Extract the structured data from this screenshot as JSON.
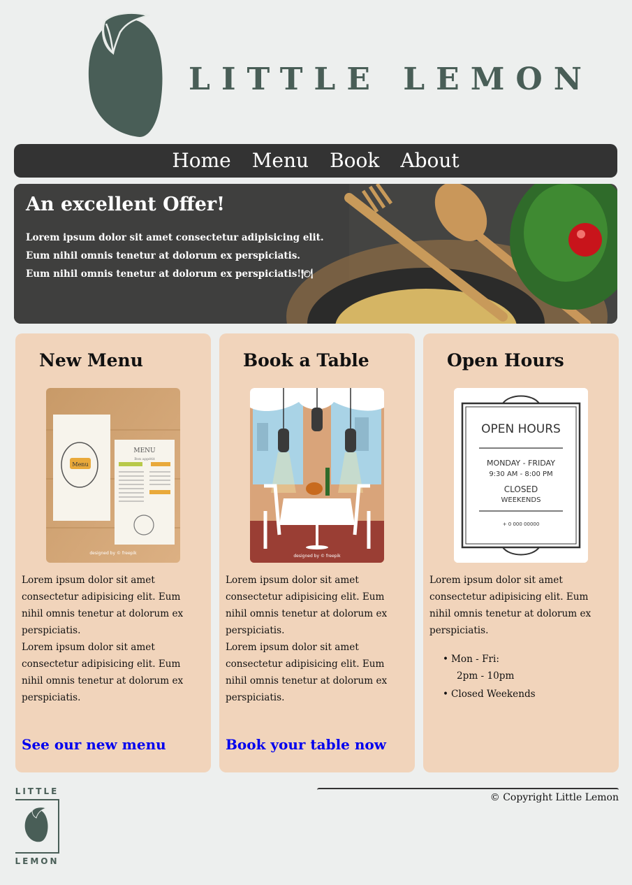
{
  "brand": {
    "name": "LITTLE LEMON",
    "footer_logo_top": "LITTLE",
    "footer_logo_bottom": "LEMON",
    "color": "#495e57"
  },
  "nav": {
    "items": [
      "Home",
      "Menu",
      "Book",
      "About"
    ],
    "background": "#333333"
  },
  "hero": {
    "title": "An excellent Offer!",
    "text": "Lorem ipsum dolor sit amet consectetur adipisicing elit. Eum nihil omnis tenetur at dolorum ex perspiciatis. Eum nihil omnis tenetur at dolorum ex perspiciatis!🍽"
  },
  "cards": [
    {
      "title": "New Menu",
      "text": "Lorem ipsum dolor sit amet consectetur adipisicing elit. Eum nihil omnis tenetur at dolorum ex perspiciatis.\nLorem ipsum dolor sit amet consectetur adipisicing elit. Eum nihil omnis tenetur at dolorum ex perspiciatis.",
      "link": "See our new menu",
      "image_icon": "menu-flyer-image"
    },
    {
      "title": "Book a Table",
      "text": "Lorem ipsum dolor sit amet consectetur adipisicing elit. Eum nihil omnis tenetur at dolorum ex perspiciatis.\nLorem ipsum dolor sit amet consectetur adipisicing elit. Eum nihil omnis tenetur at dolorum ex perspiciatis.",
      "link": "Book your table now",
      "image_icon": "restaurant-table-image"
    },
    {
      "title": "Open Hours",
      "text": "Lorem ipsum dolor sit amet consectetur adipisicing elit. Eum nihil omnis tenetur at dolorum ex perspiciatis.",
      "hours": [
        {
          "label": "Mon - Fri:",
          "sub": "2pm - 10pm"
        },
        {
          "label": "Closed Weekends",
          "sub": ""
        }
      ],
      "sign": {
        "heading": "OPEN HOURS",
        "days": "MONDAY - FRIDAY",
        "time": "9:30 AM - 8:00 PM",
        "closed": "CLOSED",
        "weekends": "WEEKENDS",
        "phone": "+ 0 000 00000"
      },
      "image_icon": "open-hours-sign-image"
    }
  ],
  "image_credit": "designed by © freepik",
  "menu_flyer": {
    "left_word": "Menu",
    "right_word": "MENU",
    "right_sub": "Bon appétit"
  },
  "footer": {
    "copyright": "© Copyright Little Lemon"
  },
  "colors": {
    "page_bg": "#edefee",
    "card_bg": "#f1d4bb",
    "link": "#0000ee"
  }
}
